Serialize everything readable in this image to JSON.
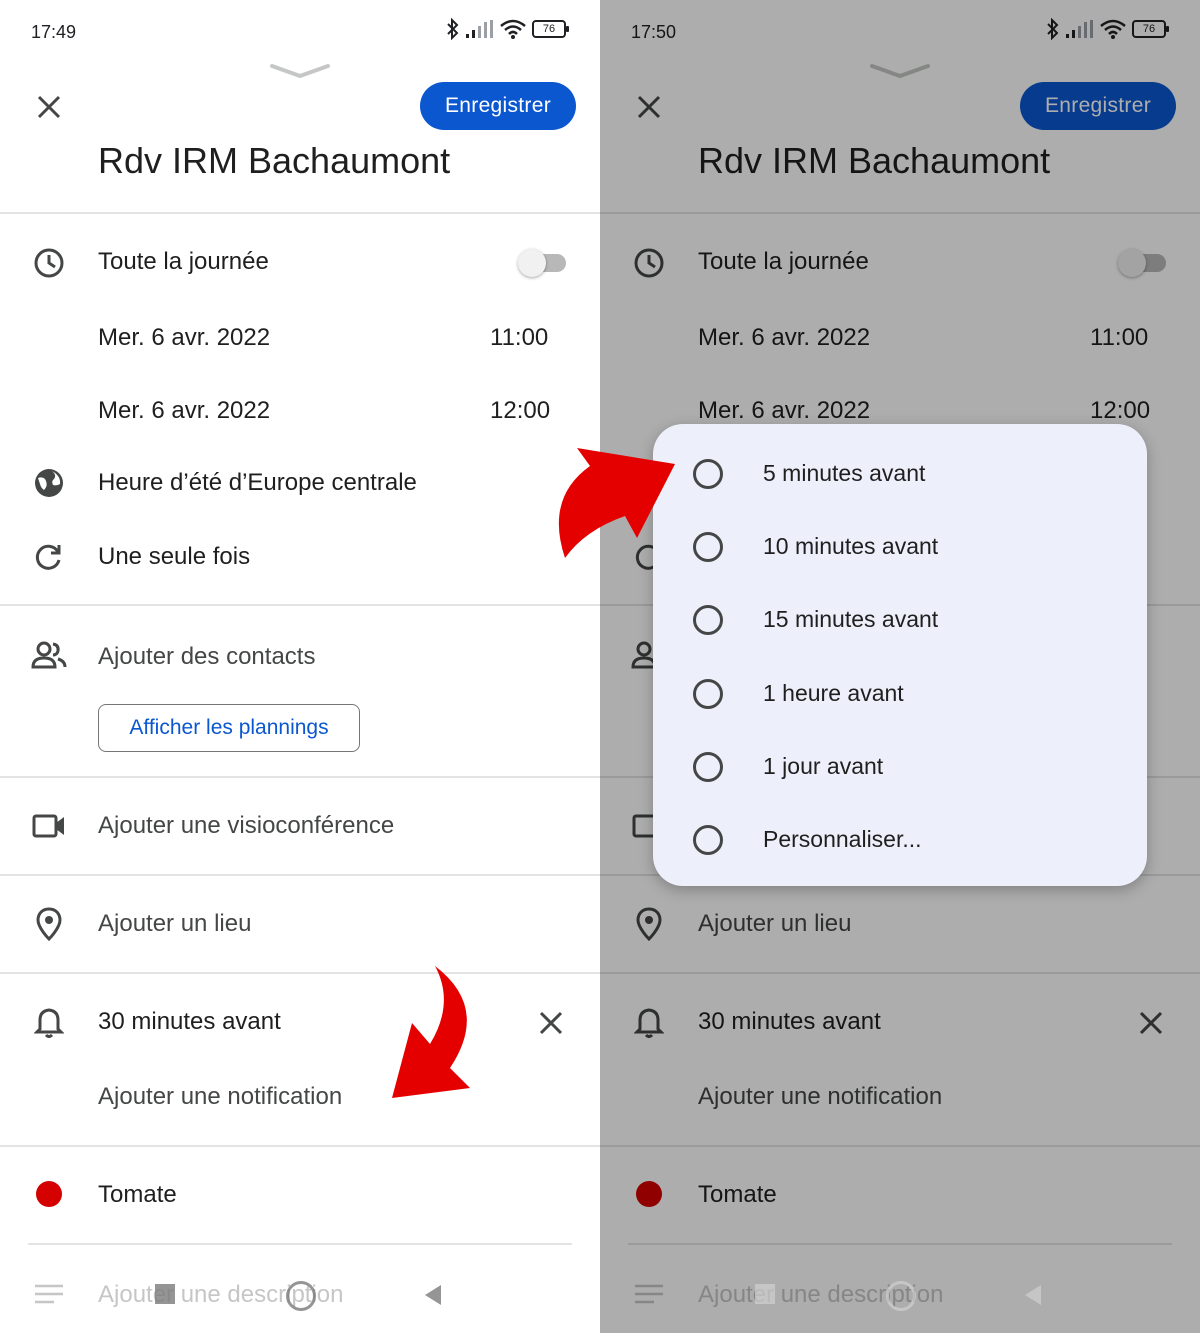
{
  "left": {
    "status_time": "17:49",
    "battery": "76"
  },
  "right": {
    "status_time": "17:50",
    "battery": "76"
  },
  "event": {
    "save_label": "Enregistrer",
    "title": "Rdv IRM Bachaumont",
    "all_day_label": "Toute la journée",
    "all_day_on": false,
    "start_date": "Mer. 6 avr. 2022",
    "start_time": "11:00",
    "end_date": "Mer. 6 avr. 2022",
    "end_time": "12:00",
    "timezone": "Heure d’été d’Europe centrale",
    "recurrence": "Une seule fois",
    "add_contacts": "Ajouter des contacts",
    "show_schedules": "Afficher les plannings",
    "add_video": "Ajouter une visioconférence",
    "add_location": "Ajouter un lieu",
    "notification": "30 minutes avant",
    "add_notification": "Ajouter une notification",
    "color_name": "Tomate",
    "color_hex": "#d50000",
    "description_placeholder": "Ajouter une description"
  },
  "dialog": {
    "options": [
      {
        "label": "5 minutes avant",
        "selected": false
      },
      {
        "label": "10 minutes avant",
        "selected": false
      },
      {
        "label": "15 minutes avant",
        "selected": false
      },
      {
        "label": "1 heure avant",
        "selected": false
      },
      {
        "label": "1 jour avant",
        "selected": false
      },
      {
        "label": "Personnaliser...",
        "selected": false
      }
    ]
  },
  "colors": {
    "accent": "#0b57d0",
    "dialog_bg": "#edf0fa",
    "annotation_arrow": "#e50000",
    "scrim": "rgba(0,0,0,0.32)"
  }
}
